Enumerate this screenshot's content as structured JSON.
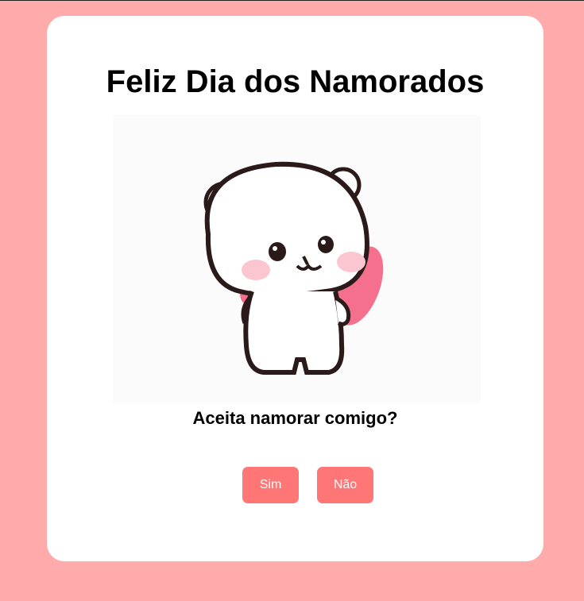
{
  "page": {
    "title": "Feliz Dia dos Namorados",
    "question": "Aceita namorar comigo?",
    "yes_label": "Sim",
    "no_label": "Não",
    "colors": {
      "background": "#ffabab",
      "card": "#ffffff",
      "button": "#ff7676",
      "button_text": "#ffffff"
    },
    "image": {
      "subject": "bear-waving-icon"
    }
  }
}
